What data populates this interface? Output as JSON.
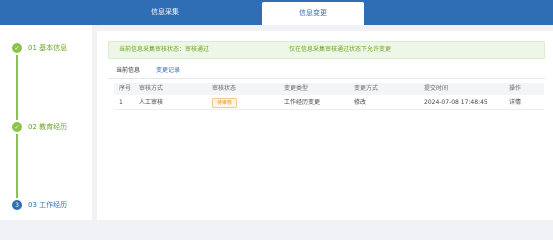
{
  "topbar": {
    "tabs": [
      "信息采集",
      "信息变更"
    ],
    "active_tab": "信息变更"
  },
  "sidebar": {
    "steps": [
      {
        "num": "✓",
        "label": "01 基本信息",
        "state": "done"
      },
      {
        "num": "✓",
        "label": "02 教育经历",
        "state": "done"
      },
      {
        "num": "3",
        "label": "03 工作经历",
        "state": "active"
      }
    ]
  },
  "notice": {
    "left": "当前信息采集审核状态：审核通过",
    "right": "仅在信息采集审核通过状态下允许变更"
  },
  "subtabs": {
    "current": "当前信息",
    "records": "变更记录"
  },
  "table": {
    "headers": [
      "序号",
      "审核方式",
      "审核状态",
      "变更类型",
      "变更方式",
      "提交时间",
      "操作"
    ],
    "rows": [
      {
        "index": "1",
        "review_method": "人工审核",
        "review_status": "待审核",
        "change_type": "工作经历变更",
        "change_mode": "修改",
        "submit_time": "2024-07-08 17:48:45",
        "action": "详情"
      }
    ]
  },
  "colors": {
    "brand": "#2f6db5",
    "success": "#8bc34a",
    "pending": "#e6902b"
  }
}
